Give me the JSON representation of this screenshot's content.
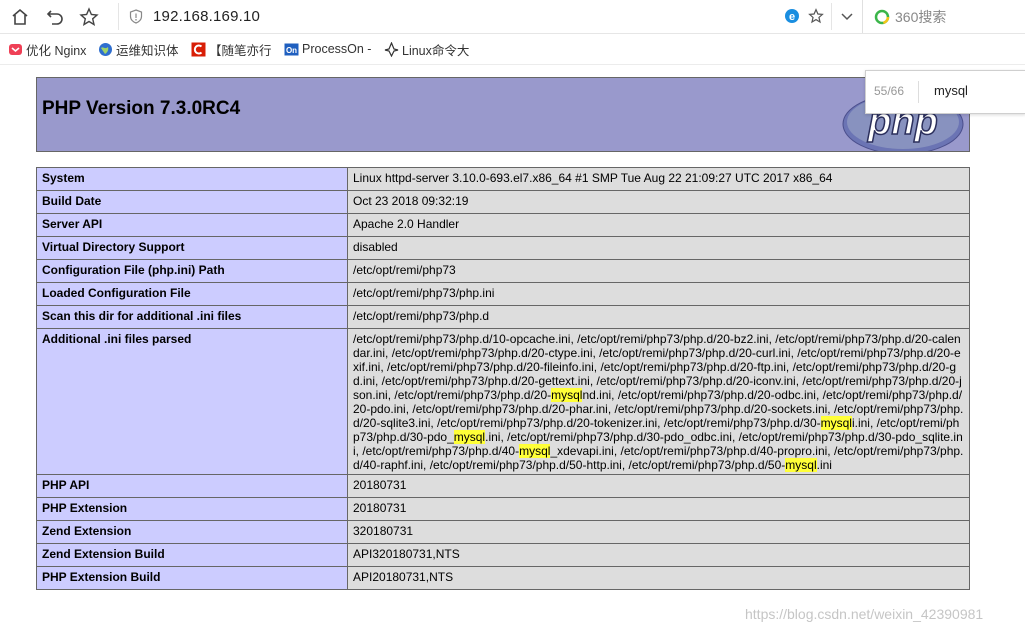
{
  "browser": {
    "url": "192.168.169.10",
    "search_engine": "360搜索",
    "bookmarks": [
      {
        "label": "优化 Nginx",
        "icon": "pocket-icon"
      },
      {
        "label": "运维知识体",
        "icon": "globe-icon"
      },
      {
        "label": "【随笔亦行",
        "icon": "csdn-icon"
      },
      {
        "label": "ProcessOn -",
        "icon": "processon-icon"
      },
      {
        "label": "Linux命令大",
        "icon": "linux-icon"
      }
    ]
  },
  "find_bar": {
    "count": "55/66",
    "query": "mysql"
  },
  "phpinfo": {
    "title": "PHP Version 7.3.0RC4",
    "rows": [
      {
        "key": "System",
        "value": "Linux httpd-server 3.10.0-693.el7.x86_64 #1 SMP Tue Aug 22 21:09:27 UTC 2017 x86_64"
      },
      {
        "key": "Build Date",
        "value": "Oct 23 2018 09:32:19"
      },
      {
        "key": "Server API",
        "value": "Apache 2.0 Handler"
      },
      {
        "key": "Virtual Directory Support",
        "value": "disabled"
      },
      {
        "key": "Configuration File (php.ini) Path",
        "value": "/etc/opt/remi/php73"
      },
      {
        "key": "Loaded Configuration File",
        "value": "/etc/opt/remi/php73/php.ini"
      },
      {
        "key": "Scan this dir for additional .ini files",
        "value": "/etc/opt/remi/php73/php.d"
      },
      {
        "key": "Additional .ini files parsed",
        "value": "/etc/opt/remi/php73/php.d/10-opcache.ini, /etc/opt/remi/php73/php.d/20-bz2.ini, /etc/opt/remi/php73/php.d/20-calendar.ini, /etc/opt/remi/php73/php.d/20-ctype.ini, /etc/opt/remi/php73/php.d/20-curl.ini, /etc/opt/remi/php73/php.d/20-exif.ini, /etc/opt/remi/php73/php.d/20-fileinfo.ini, /etc/opt/remi/php73/php.d/20-ftp.ini, /etc/opt/remi/php73/php.d/20-gd.ini, /etc/opt/remi/php73/php.d/20-gettext.ini, /etc/opt/remi/php73/php.d/20-iconv.ini, /etc/opt/remi/php73/php.d/20-json.ini, /etc/opt/remi/php73/php.d/20-mysqlnd.ini, /etc/opt/remi/php73/php.d/20-odbc.ini, /etc/opt/remi/php73/php.d/20-pdo.ini, /etc/opt/remi/php73/php.d/20-phar.ini, /etc/opt/remi/php73/php.d/20-sockets.ini, /etc/opt/remi/php73/php.d/20-sqlite3.ini, /etc/opt/remi/php73/php.d/20-tokenizer.ini, /etc/opt/remi/php73/php.d/30-mysqli.ini, /etc/opt/remi/php73/php.d/30-pdo_mysql.ini, /etc/opt/remi/php73/php.d/30-pdo_odbc.ini, /etc/opt/remi/php73/php.d/30-pdo_sqlite.ini, /etc/opt/remi/php73/php.d/40-mysql_xdevapi.ini, /etc/opt/remi/php73/php.d/40-propro.ini, /etc/opt/remi/php73/php.d/40-raphf.ini, /etc/opt/remi/php73/php.d/50-http.ini, /etc/opt/remi/php73/php.d/50-mysql.ini"
      },
      {
        "key": "PHP API",
        "value": "20180731"
      },
      {
        "key": "PHP Extension",
        "value": "20180731"
      },
      {
        "key": "Zend Extension",
        "value": "320180731"
      },
      {
        "key": "Zend Extension Build",
        "value": "API320180731,NTS"
      },
      {
        "key": "PHP Extension Build",
        "value": "API20180731,NTS"
      }
    ]
  },
  "watermark": "https://blog.csdn.net/weixin_42390981",
  "colors": {
    "header_bg": "#9999cc",
    "key_bg": "#ccccff",
    "value_bg": "#dddddd",
    "highlight": "#ffff38"
  }
}
